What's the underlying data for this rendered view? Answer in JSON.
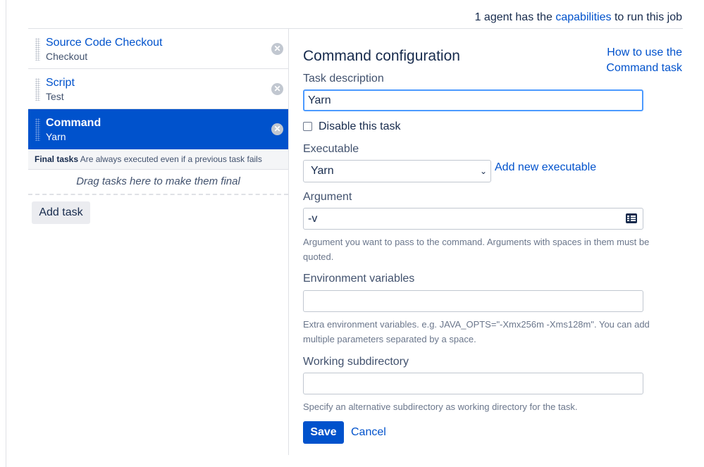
{
  "header": {
    "agents_prefix": "1 agent has the ",
    "capabilities_link": "capabilities",
    "agents_suffix": " to run this job"
  },
  "tasks": [
    {
      "name": "Source Code Checkout",
      "type": "Checkout",
      "selected": false
    },
    {
      "name": "Script",
      "type": "Test",
      "selected": false
    },
    {
      "name": "Command",
      "type": "Yarn",
      "selected": true
    }
  ],
  "final_tasks": {
    "title": "Final tasks",
    "description": "Are always executed even if a previous task fails",
    "drop_hint": "Drag tasks here to make them final"
  },
  "add_task_label": "Add task",
  "form": {
    "title": "Command configuration",
    "help_link_line1": "How to use the",
    "help_link_line2": "Command task",
    "task_description_label": "Task description",
    "task_description_value": "Yarn",
    "disable_task_label": "Disable this task",
    "disable_task_checked": false,
    "executable_label": "Executable",
    "executable_value": "Yarn",
    "add_executable_link": "Add new executable",
    "argument_label": "Argument",
    "argument_value": "-v",
    "argument_help_line1": "Argument you want to pass to the command. Arguments with spaces in them must be",
    "argument_help_line2": "quoted.",
    "env_vars_label": "Environment variables",
    "env_vars_value": "",
    "env_vars_help_line1": "Extra environment variables. e.g. JAVA_OPTS=\"-Xmx256m -Xms128m\". You can add",
    "env_vars_help_line2": "multiple parameters separated by a space.",
    "working_dir_label": "Working subdirectory",
    "working_dir_value": "",
    "working_dir_help": "Specify an alternative subdirectory as working directory for the task.",
    "save_label": "Save",
    "cancel_label": "Cancel"
  },
  "colors": {
    "accent": "#0052cc",
    "focus": "#4c9aff",
    "border": "#dfe1e6",
    "muted_text": "#6b778c"
  },
  "icons": {
    "remove": "close-circle-icon",
    "drag": "drag-handle-icon",
    "variables": "variables-card-icon",
    "dropdown": "chevron-down-icon"
  }
}
